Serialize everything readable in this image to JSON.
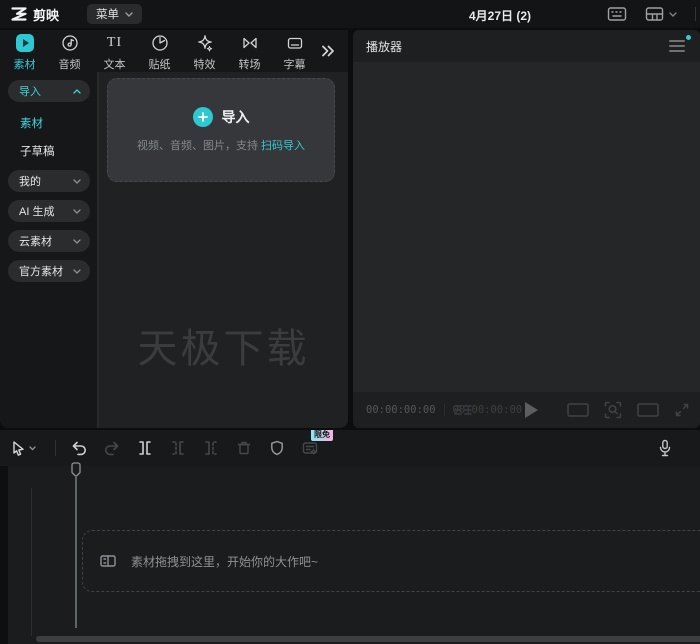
{
  "topbar": {
    "logo_text": "剪映",
    "menu_label": "菜单",
    "project_title": "4月27日 (2)"
  },
  "tabs": [
    {
      "label": "素材",
      "active": true
    },
    {
      "label": "音频"
    },
    {
      "label": "文本",
      "icon_text": "TI"
    },
    {
      "label": "贴纸"
    },
    {
      "label": "特效"
    },
    {
      "label": "转场"
    },
    {
      "label": "字幕"
    }
  ],
  "sidebar": {
    "items": [
      {
        "label": "导入",
        "expanded": true,
        "active": true
      },
      {
        "label": "素材",
        "active": true
      },
      {
        "label": "子草稿"
      },
      {
        "label": "我的"
      },
      {
        "label": "AI 生成"
      },
      {
        "label": "云素材"
      },
      {
        "label": "官方素材"
      }
    ]
  },
  "import_box": {
    "title": "导入",
    "subtitle_prefix": "视频、音频、图片，支持 ",
    "subtitle_link": "扫码导入"
  },
  "watermark": "天极下载",
  "player": {
    "title": "播放器",
    "current_time": "00:00:00:00",
    "total_time": "00:00:00:00"
  },
  "toolbar": {
    "free_badge": "限免"
  },
  "timeline": {
    "empty_hint": "素材拖拽到这里，开始你的大作吧~"
  },
  "colors": {
    "accent": "#3ac8d2",
    "badge_gradient_start": "#8ae8f2",
    "badge_gradient_end": "#f5b1dd",
    "panel_bg": "#1f2123",
    "topbar_bg": "#131416"
  }
}
